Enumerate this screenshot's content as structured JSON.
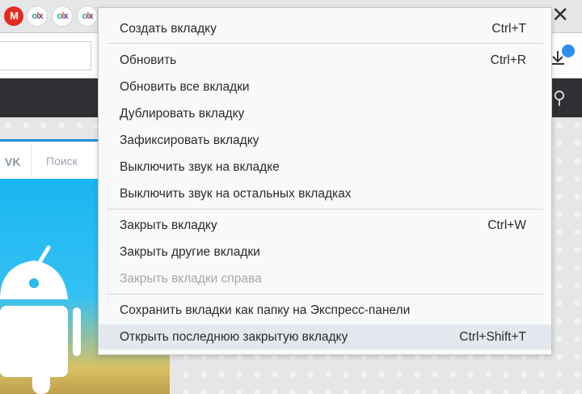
{
  "tabs": [
    {
      "icon": "mega-icon",
      "text": "M"
    },
    {
      "icon": "olx-icon",
      "text": "OLX"
    },
    {
      "icon": "olx-icon",
      "text": "OLX"
    },
    {
      "icon": "olx-icon",
      "text": "OLX"
    }
  ],
  "window": {
    "close_glyph": "✕"
  },
  "page": {
    "vk_logo": "VK",
    "search_placeholder": "Поиск"
  },
  "context_menu": {
    "groups": [
      [
        {
          "label": "Создать вкладку",
          "shortcut": "Ctrl+T",
          "enabled": true
        }
      ],
      [
        {
          "label": "Обновить",
          "shortcut": "Ctrl+R",
          "enabled": true
        },
        {
          "label": "Обновить все вкладки",
          "shortcut": "",
          "enabled": true
        },
        {
          "label": "Дублировать вкладку",
          "shortcut": "",
          "enabled": true
        },
        {
          "label": "Зафиксировать вкладку",
          "shortcut": "",
          "enabled": true
        },
        {
          "label": "Выключить звук на вкладке",
          "shortcut": "",
          "enabled": true
        },
        {
          "label": "Выключить звук на остальных вкладках",
          "shortcut": "",
          "enabled": true
        }
      ],
      [
        {
          "label": "Закрыть вкладку",
          "shortcut": "Ctrl+W",
          "enabled": true
        },
        {
          "label": "Закрыть другие вкладки",
          "shortcut": "",
          "enabled": true
        },
        {
          "label": "Закрыть вкладки справа",
          "shortcut": "",
          "enabled": false
        }
      ],
      [
        {
          "label": "Сохранить вкладки как папку на Экспресс-панели",
          "shortcut": "",
          "enabled": true
        },
        {
          "label": "Открыть последнюю закрытую вкладку",
          "shortcut": "Ctrl+Shift+T",
          "enabled": true,
          "highlighted": true
        }
      ]
    ]
  },
  "colors": {
    "menu_bg": "#f9f9f9",
    "highlight": "#e3e8ee",
    "disabled_text": "#a6a6a6",
    "accent": "#2f8df0"
  }
}
